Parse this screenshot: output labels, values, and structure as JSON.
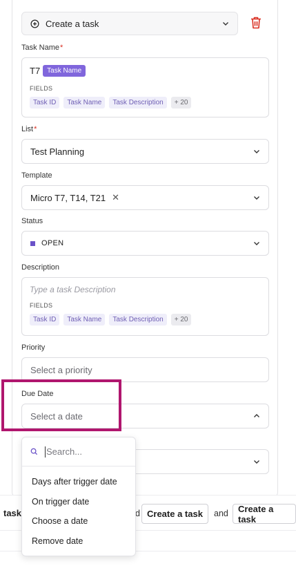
{
  "action": {
    "label": "Create a task",
    "icon": "plus-circle-icon"
  },
  "task_name": {
    "label": "Task Name",
    "required_mark": "*",
    "value_prefix": "T7",
    "token": "Task Name",
    "fields_title": "FIELDS",
    "chips": [
      "Task ID",
      "Task Name",
      "Task Description"
    ],
    "more": "+ 20"
  },
  "list": {
    "label": "List",
    "required_mark": "*",
    "value": "Test Planning"
  },
  "template": {
    "label": "Template",
    "value": "Micro T7, T14, T21",
    "clear": "✕"
  },
  "status": {
    "label": "Status",
    "value": "OPEN",
    "color": "#6a52c8"
  },
  "description": {
    "label": "Description",
    "placeholder": "Type a task Description",
    "fields_title": "FIELDS",
    "chips": [
      "Task ID",
      "Task Name",
      "Task Description"
    ],
    "more": "+ 20"
  },
  "priority": {
    "label": "Priority",
    "placeholder": "Select a priority"
  },
  "due_date": {
    "label": "Due Date",
    "placeholder": "Select a date"
  },
  "due_dropdown": {
    "search_placeholder": "Search...",
    "options": [
      "Days after trigger date",
      "On trigger date",
      "Choose a date",
      "Remove date"
    ]
  },
  "bottom_bar": {
    "left_text": "task",
    "connector": "and",
    "button1": "Create a task",
    "button2": "Create a task"
  },
  "colors": {
    "accent": "#8066dc",
    "highlight": "#b0166e",
    "danger": "#d92d20"
  }
}
